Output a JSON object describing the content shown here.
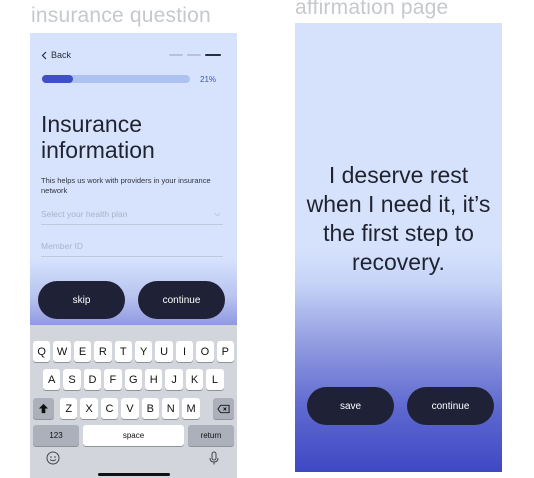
{
  "labels": {
    "left": "insurance question",
    "right": "affirmation page"
  },
  "insurance": {
    "back_label": "Back",
    "progress_percent": 21,
    "progress_text": "21%",
    "title": "Insurance information",
    "subtitle": "This helps us work with providers in your insurance network",
    "plan_placeholder": "Select your health plan",
    "member_placeholder": "Member ID",
    "skip_label": "skip",
    "continue_label": "continue"
  },
  "keyboard": {
    "row1": [
      "Q",
      "W",
      "E",
      "R",
      "T",
      "Y",
      "U",
      "I",
      "O",
      "P"
    ],
    "row2": [
      "A",
      "S",
      "D",
      "F",
      "G",
      "H",
      "J",
      "K",
      "L"
    ],
    "row3": [
      "Z",
      "X",
      "C",
      "V",
      "B",
      "N",
      "M"
    ],
    "numbers_label": "123",
    "space_label": "space",
    "return_label": "return"
  },
  "affirmation": {
    "text": "I deserve rest when I need it, it’s the first step to recovery.",
    "save_label": "save",
    "continue_label": "continue"
  },
  "colors": {
    "accent": "#3e4fc7",
    "button_dark": "#1f2237",
    "screen_bg": "#d6e2fc"
  }
}
